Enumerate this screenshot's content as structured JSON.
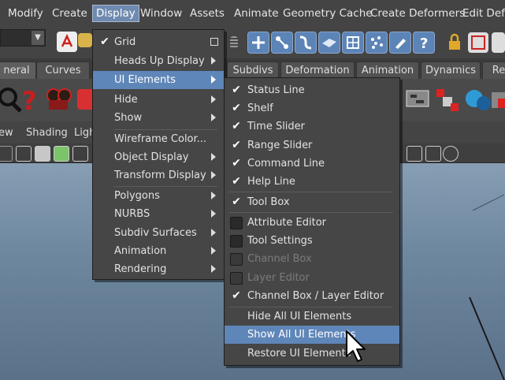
{
  "menubar": {
    "items": [
      "Modify",
      "Create",
      "Display",
      "Window",
      "Assets",
      "Animate",
      "Geometry Cache",
      "Create Deformers",
      "Edit Defo"
    ],
    "active_index": 2
  },
  "shelf_tabs": [
    "neral",
    "Curves",
    "Subdivs",
    "Deformation",
    "Animation",
    "Dynamics",
    "Re"
  ],
  "panel_menu": [
    "ew",
    "Shading",
    "Ligh"
  ],
  "display_menu": {
    "items": [
      {
        "label": "Grid",
        "checked": true,
        "option_box": true
      },
      {
        "label": "Heads Up Display",
        "submenu": true
      },
      {
        "label": "UI Elements",
        "submenu": true,
        "highlighted": true
      },
      {
        "label": "Hide",
        "submenu": true
      },
      {
        "label": "Show",
        "submenu": true
      },
      {
        "label": "Wireframe Color..."
      },
      {
        "label": "Object Display",
        "submenu": true
      },
      {
        "label": "Transform Display",
        "submenu": true
      },
      {
        "label": "Polygons",
        "submenu": true
      },
      {
        "label": "NURBS",
        "submenu": true
      },
      {
        "label": "Subdiv Surfaces",
        "submenu": true
      },
      {
        "label": "Animation",
        "submenu": true
      },
      {
        "label": "Rendering",
        "submenu": true
      }
    ]
  },
  "ui_elements_menu": {
    "items": [
      {
        "label": "Status Line",
        "checked": true
      },
      {
        "label": "Shelf",
        "checked": true
      },
      {
        "label": "Time Slider",
        "checked": true
      },
      {
        "label": "Range Slider",
        "checked": true
      },
      {
        "label": "Command Line",
        "checked": true
      },
      {
        "label": "Help Line",
        "checked": true
      },
      {
        "label": "Tool Box",
        "checked": true
      },
      {
        "label": "Attribute Editor",
        "checked": false
      },
      {
        "label": "Tool Settings",
        "checked": false
      },
      {
        "label": "Channel Box",
        "checked": false,
        "disabled": true
      },
      {
        "label": "Layer Editor",
        "checked": false,
        "disabled": true
      },
      {
        "label": "Channel Box / Layer Editor",
        "checked": true
      },
      {
        "label": "Hide All UI Elements"
      },
      {
        "label": "Show All UI Elements",
        "highlighted": true
      },
      {
        "label": "Restore UI Elements"
      }
    ]
  },
  "colors": {
    "highlight": "#5f86b8",
    "menu_bg": "#464646",
    "viewport": "#7a92a8"
  },
  "icons": [
    "dropdown-arrow-icon",
    "pdf-icon",
    "folder-icon",
    "move-icon",
    "snap-icon",
    "curve-icon",
    "plane-icon",
    "grid-icon",
    "particles-icon",
    "paint-icon",
    "help-icon",
    "lock-icon",
    "render-icon",
    "cursor-icon"
  ]
}
